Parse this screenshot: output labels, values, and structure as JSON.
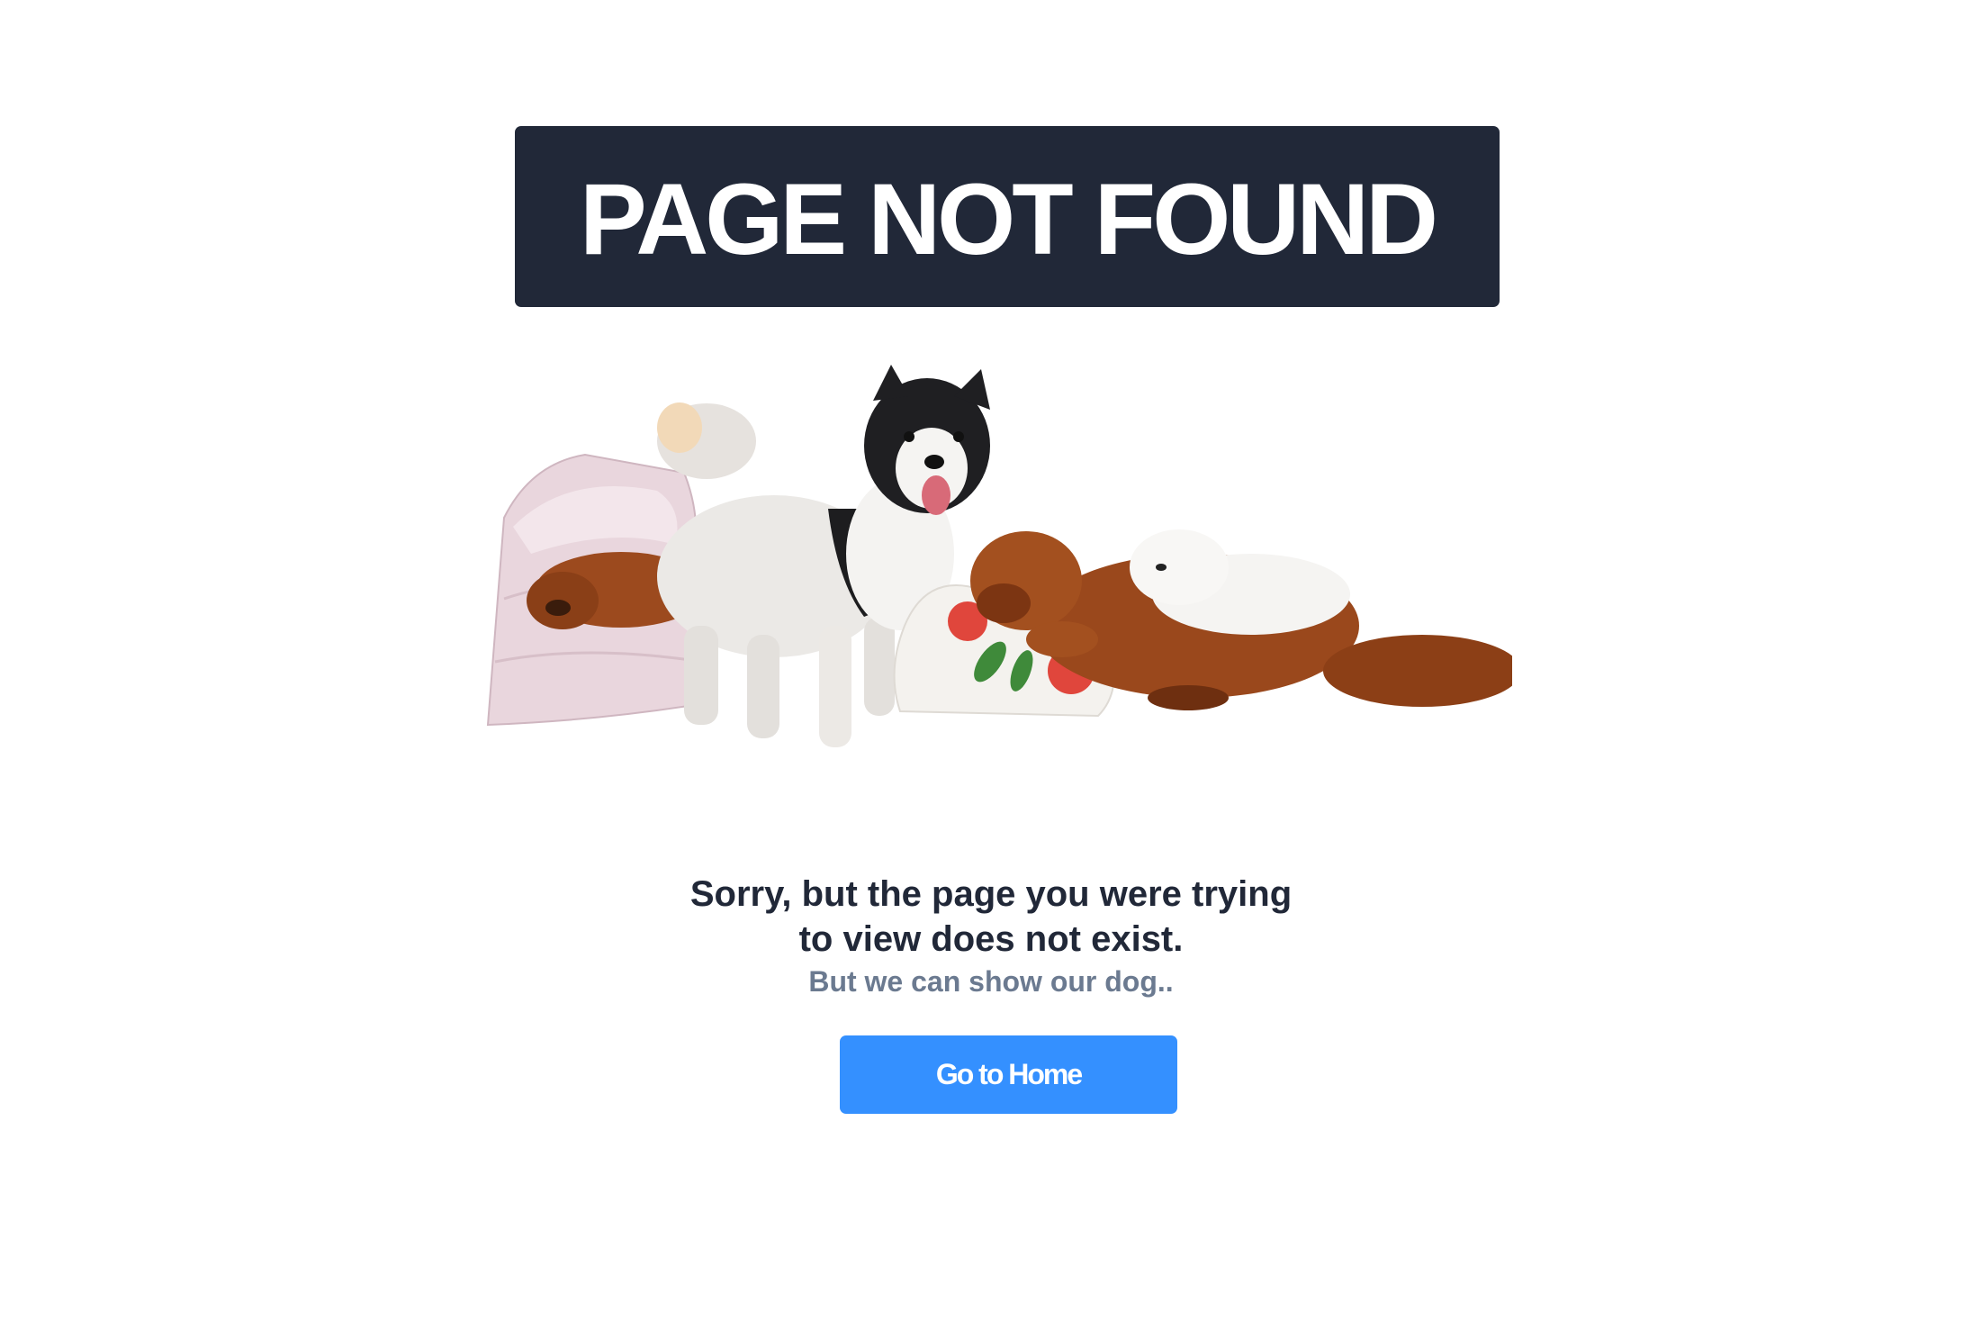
{
  "header": {
    "title": "PAGE NOT FOUND",
    "background_color": "#212838"
  },
  "illustration": {
    "icon": "dogs-illustration"
  },
  "message": {
    "line1": "Sorry, but the page you were trying",
    "line2": "to view does not exist.",
    "subtitle": "But we can show our dog.."
  },
  "home_button": {
    "label": "Go to Home",
    "color": "#3490ff"
  }
}
